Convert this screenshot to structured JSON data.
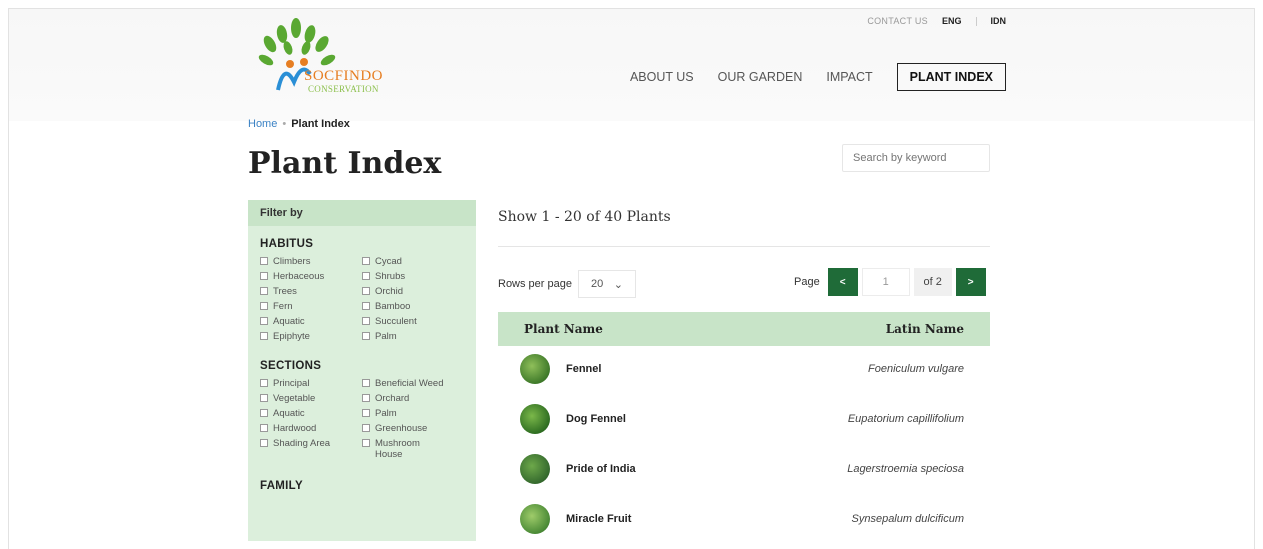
{
  "header": {
    "logo_line1": "SOCFINDO",
    "logo_line2": "CONSERVATION",
    "contact": "CONTACT US",
    "lang_en": "ENG",
    "lang_id": "IDN",
    "nav": [
      "ABOUT US",
      "OUR GARDEN",
      "IMPACT",
      "PLANT INDEX"
    ]
  },
  "breadcrumb": {
    "home": "Home",
    "current": "Plant Index"
  },
  "page_title": "Plant Index",
  "search": {
    "placeholder": "Search by keyword"
  },
  "filter": {
    "title": "Filter by",
    "habitus_title": "HABITUS",
    "habitus": [
      "Climbers",
      "Cycad",
      "Herbaceous",
      "Shrubs",
      "Trees",
      "Orchid",
      "Fern",
      "Bamboo",
      "Aquatic",
      "Succulent",
      "Epiphyte",
      "Palm"
    ],
    "sections_title": "SECTIONS",
    "sections": [
      "Principal",
      "Beneficial Weed",
      "Vegetable",
      "Orchard",
      "Aquatic",
      "Palm",
      "Hardwood",
      "Greenhouse",
      "Shading Area",
      "Mushroom House"
    ],
    "family_title": "FAMILY"
  },
  "listing": {
    "showing": "Show 1 - 20 of 40 Plants",
    "rows_label": "Rows per page",
    "rows_value": "20",
    "page_label": "Page",
    "prev": "<",
    "next": ">",
    "page_value": "1",
    "page_of": "of 2"
  },
  "table": {
    "col_name": "Plant Name",
    "col_latin": "Latin Name",
    "rows": [
      {
        "name": "Fennel",
        "latin": "Foeniculum vulgare"
      },
      {
        "name": "Dog Fennel",
        "latin": "Eupatorium capillifolium"
      },
      {
        "name": "Pride of India",
        "latin": "Lagerstroemia speciosa"
      },
      {
        "name": "Miracle Fruit",
        "latin": "Synsepalum dulcificum"
      }
    ]
  },
  "colors": {
    "brand_green": "#1f6b38",
    "filter_bg": "#dcefdc",
    "link_blue": "#3b82c4"
  }
}
